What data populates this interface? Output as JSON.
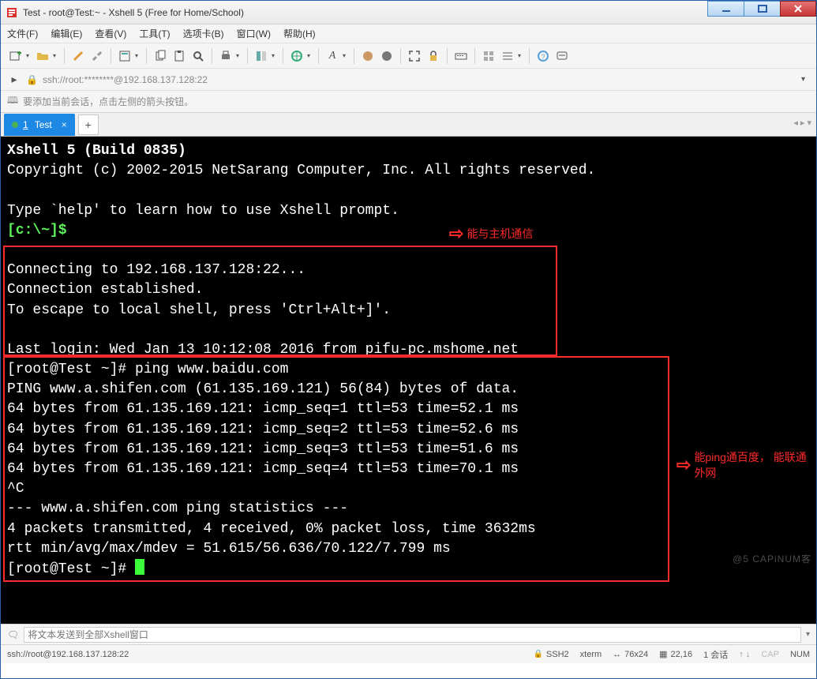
{
  "window": {
    "title": "Test - root@Test:~ - Xshell 5 (Free for Home/School)"
  },
  "menu": {
    "items": [
      "文件(F)",
      "编辑(E)",
      "查看(V)",
      "工具(T)",
      "选项卡(B)",
      "窗口(W)",
      "帮助(H)"
    ]
  },
  "address": {
    "text": "ssh://root:********@192.168.137.128:22"
  },
  "hint": {
    "text": "要添加当前会话，点击左侧的箭头按钮。"
  },
  "tabs": {
    "active_num": "1",
    "active_label": "Test"
  },
  "terminal": {
    "l1": "Xshell 5 (Build 0835)",
    "l2": "Copyright (c) 2002-2015 NetSarang Computer, Inc. All rights reserved.",
    "l3": "",
    "l4": "Type `help' to learn how to use Xshell prompt.",
    "prompt1": "[c:\\~]$ ",
    "l6": "",
    "l7": "Connecting to 192.168.137.128:22...",
    "l8": "Connection established.",
    "l9": "To escape to local shell, press 'Ctrl+Alt+]'.",
    "l10": "",
    "l11": "Last login: Wed Jan 13 10:12:08 2016 from pifu-pc.mshome.net",
    "l12": "[root@Test ~]# ping www.baidu.com",
    "l13": "PING www.a.shifen.com (61.135.169.121) 56(84) bytes of data.",
    "l14": "64 bytes from 61.135.169.121: icmp_seq=1 ttl=53 time=52.1 ms",
    "l15": "64 bytes from 61.135.169.121: icmp_seq=2 ttl=53 time=52.6 ms",
    "l16": "64 bytes from 61.135.169.121: icmp_seq=3 ttl=53 time=51.6 ms",
    "l17": "64 bytes from 61.135.169.121: icmp_seq=4 ttl=53 time=70.1 ms",
    "l18": "^C",
    "l19": "--- www.a.shifen.com ping statistics ---",
    "l20": "4 packets transmitted, 4 received, 0% packet loss, time 3632ms",
    "l21": "rtt min/avg/max/mdev = 51.615/56.636/70.122/7.799 ms",
    "l22": "[root@Test ~]# "
  },
  "annotations": {
    "a1": "能与主机通信",
    "a2_l1": "能ping通百度，",
    "a2_l2": "能联通外网"
  },
  "watermark": "@5 CAPiNUM客",
  "sendbar": {
    "placeholder": "将文本发送到全部Xshell窗口"
  },
  "status": {
    "left": "ssh://root@192.168.137.128:22",
    "ssh": "SSH2",
    "term": "xterm",
    "size": "76x24",
    "pos": "22,16",
    "sessions": "1 会话",
    "caps": "CAP",
    "num": "NUM"
  }
}
